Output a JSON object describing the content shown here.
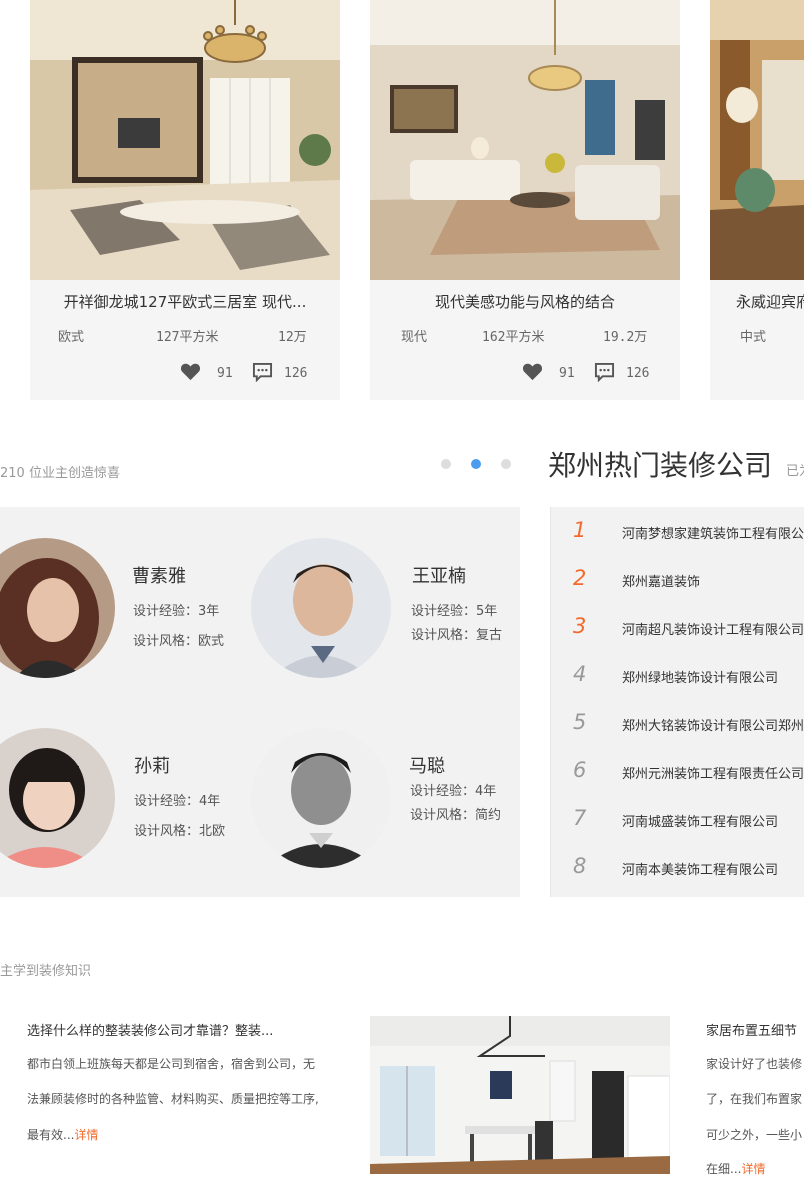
{
  "cases": [
    {
      "title": "开祥御龙城127平欧式三居室 现代...",
      "style": "欧式",
      "area": "127平方米",
      "price": "12万",
      "likes": "91",
      "comments": "126"
    },
    {
      "title": "现代美感功能与风格的结合",
      "style": "现代",
      "area": "162平方米",
      "price": "19.2万",
      "likes": "91",
      "comments": "126"
    },
    {
      "title": "永威迎宾府",
      "style": "中式",
      "area": "",
      "price": "",
      "likes": "",
      "comments": ""
    }
  ],
  "designers_section": {
    "caption": "210 位业主创造惊喜",
    "exp_label": "设计经验：",
    "style_label": "设计风格：",
    "designers": [
      {
        "name": "曹素雅",
        "experience": "3年",
        "style": "欧式"
      },
      {
        "name": "王亚楠",
        "experience": "5年",
        "style": "复古"
      },
      {
        "name": "孙莉",
        "experience": "4年",
        "style": "北欧"
      },
      {
        "name": "马聪",
        "experience": "4年",
        "style": "简约"
      }
    ]
  },
  "ranking": {
    "title": "郑州热门装修公司",
    "subtitle": "已为",
    "companies": [
      {
        "rank": "1",
        "name": "河南梦想家建筑装饰工程有限公司"
      },
      {
        "rank": "2",
        "name": "郑州嘉道装饰"
      },
      {
        "rank": "3",
        "name": "河南超凡装饰设计工程有限公司"
      },
      {
        "rank": "4",
        "name": "郑州绿地装饰设计有限公司"
      },
      {
        "rank": "5",
        "name": "郑州大铭装饰设计有限公司郑州"
      },
      {
        "rank": "6",
        "name": "郑州元洲装饰工程有限责任公司"
      },
      {
        "rank": "7",
        "name": "河南城盛装饰工程有限公司"
      },
      {
        "rank": "8",
        "name": "河南本美装饰工程有限公司"
      }
    ]
  },
  "knowledge": {
    "caption": "主学到装修知识",
    "articles": [
      {
        "title": "选择什么样的整装装修公司才靠谱？整装...",
        "lines": [
          "都市白领上班族每天都是公司到宿舍，宿舍到公司，无",
          "法兼顾装修时的各种监管、材料购买、质量把控等工序,",
          "最有效..."
        ],
        "more": "详情"
      },
      {
        "title": "家居布置五细节",
        "lines": [
          "家设计好了也装修",
          "了，在我们布置家",
          "可少之外，一些小",
          "在细..."
        ],
        "more": "详情"
      }
    ]
  },
  "colors": {
    "accent": "#f26b2c",
    "dot_active": "#4a9cf0",
    "panel": "#f2f2f2"
  }
}
